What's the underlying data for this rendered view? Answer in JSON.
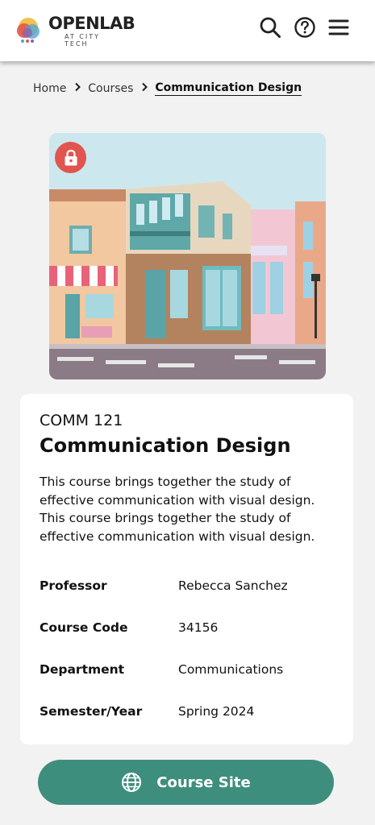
{
  "header": {
    "logo_main": "OPENLAB",
    "logo_sub": "AT CITY TECH",
    "icons": [
      "search-icon",
      "help-icon",
      "menu-icon"
    ]
  },
  "breadcrumb": {
    "items": [
      {
        "label": "Home"
      },
      {
        "label": "Courses"
      },
      {
        "label": "Communication Design"
      }
    ]
  },
  "hero": {
    "image": "illustration of colorful street-corner storefronts",
    "locked": true,
    "lock_icon": "lock-icon"
  },
  "course": {
    "code_title": "COMM 121",
    "title": "Communication Design",
    "description": "This course brings together the study of effective communication with visual design. This course brings together the study of effective communication with visual design.",
    "details": [
      {
        "label": "Professor",
        "value": "Rebecca Sanchez"
      },
      {
        "label": "Course Code",
        "value": "34156"
      },
      {
        "label": "Department",
        "value": "Communications"
      },
      {
        "label": "Semester/Year",
        "value": "Spring 2024"
      }
    ]
  },
  "button": {
    "label": "Course Site",
    "icon": "globe-icon"
  },
  "colors": {
    "accent": "#3e8e7e",
    "lock_badge": "#e0554f",
    "page_background": "#f2f2f2"
  }
}
